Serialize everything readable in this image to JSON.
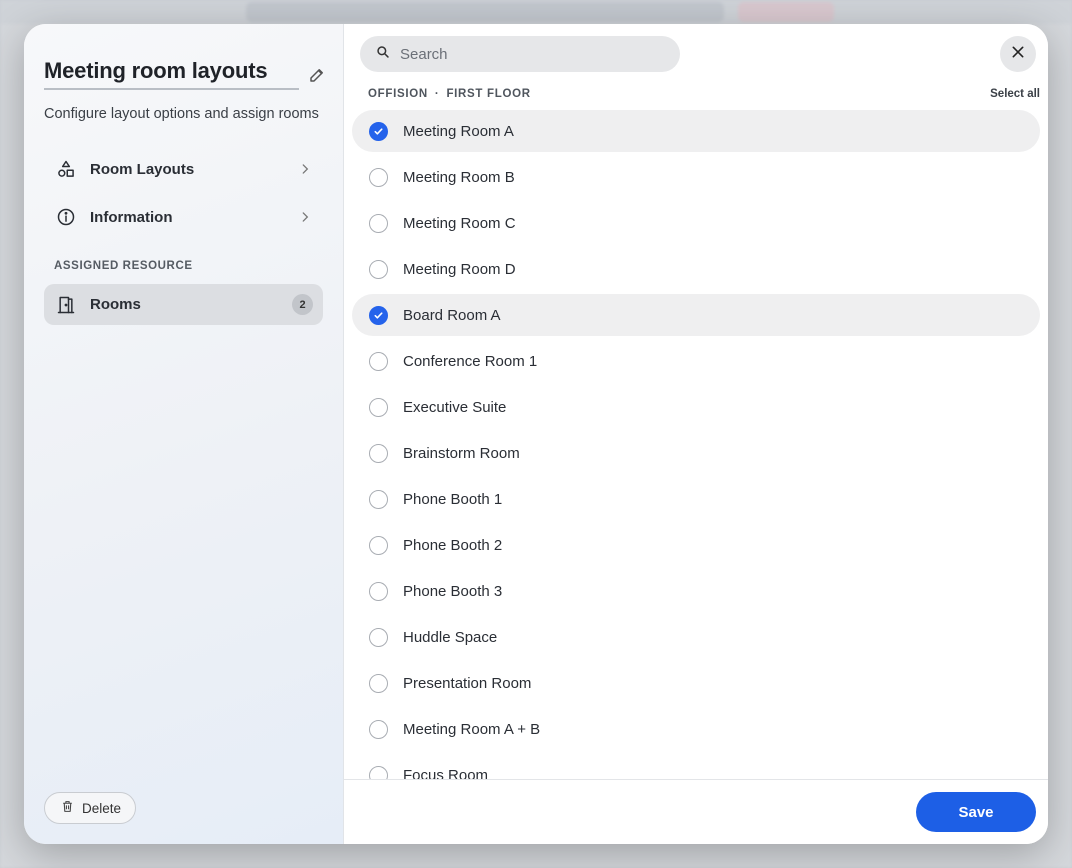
{
  "colors": {
    "accent": "#1d5fe6",
    "checked": "#2563eb",
    "selected_row_bg": "#efeff0",
    "nav_active_bg": "#dcdee2"
  },
  "sidebar": {
    "title": "Meeting room layouts",
    "subtitle": "Configure layout options and assign rooms",
    "nav": [
      {
        "label": "Room Layouts",
        "icon": "shapes-icon"
      },
      {
        "label": "Information",
        "icon": "info-icon"
      }
    ],
    "section_label": "ASSIGNED RESOURCE",
    "rooms_item": {
      "label": "Rooms",
      "count": "2",
      "icon": "door-icon"
    },
    "delete_label": "Delete"
  },
  "main": {
    "search": {
      "placeholder": "Search",
      "value": ""
    },
    "breadcrumb": {
      "building": "OFFISION",
      "separator": "·",
      "floor": "FIRST FLOOR"
    },
    "select_all_label": "Select all",
    "rooms": [
      {
        "name": "Meeting Room A",
        "selected": true
      },
      {
        "name": "Meeting Room B",
        "selected": false
      },
      {
        "name": "Meeting Room C",
        "selected": false
      },
      {
        "name": "Meeting Room D",
        "selected": false
      },
      {
        "name": "Board Room A",
        "selected": true
      },
      {
        "name": "Conference Room 1",
        "selected": false
      },
      {
        "name": "Executive Suite",
        "selected": false
      },
      {
        "name": "Brainstorm Room",
        "selected": false
      },
      {
        "name": "Phone Booth 1",
        "selected": false
      },
      {
        "name": "Phone Booth 2",
        "selected": false
      },
      {
        "name": "Phone Booth 3",
        "selected": false
      },
      {
        "name": "Huddle Space",
        "selected": false
      },
      {
        "name": "Presentation Room",
        "selected": false
      },
      {
        "name": "Meeting Room A + B",
        "selected": false
      },
      {
        "name": "Focus Room",
        "selected": false
      }
    ],
    "save_label": "Save"
  }
}
